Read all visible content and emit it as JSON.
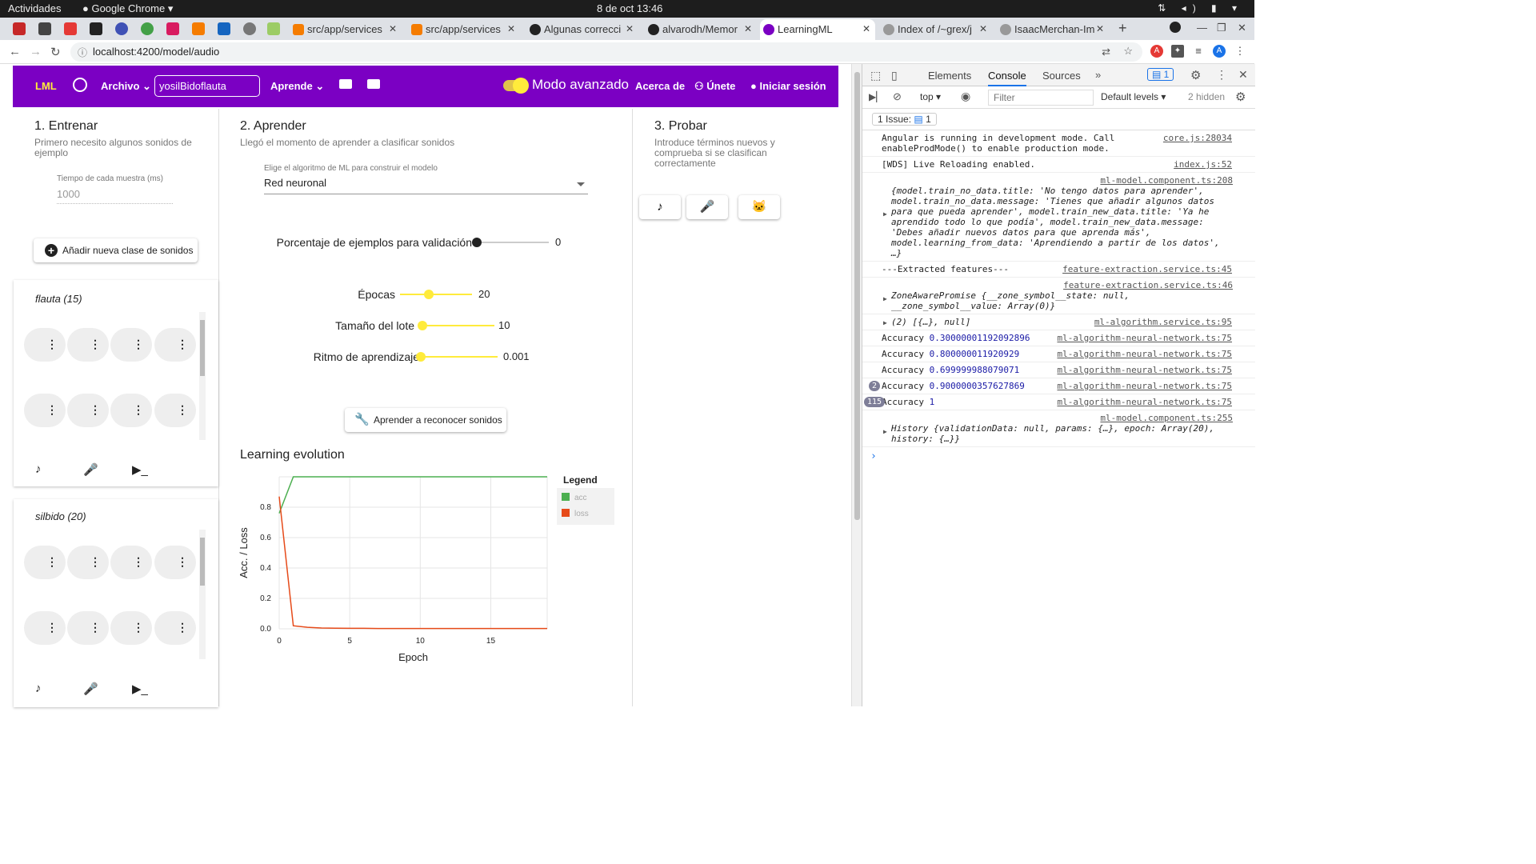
{
  "os": {
    "activities": "Actividades",
    "app_name": "Google Chrome",
    "clock": "8 de oct  13:46"
  },
  "browser": {
    "tabs": [
      {
        "title": "src/app/services",
        "color": "#f57c00"
      },
      {
        "title": "src/app/services",
        "color": "#f57c00"
      },
      {
        "title": "Algunas correcci",
        "color": "#222222"
      },
      {
        "title": "alvarodh/Memor",
        "color": "#222222"
      },
      {
        "title": "LearningML",
        "color": "#7b00c3"
      },
      {
        "title": "Index of /~grex/j",
        "color": "#888888"
      },
      {
        "title": "IsaacMerchan-Im",
        "color": "#888888"
      }
    ],
    "url": "localhost:4200/model/audio"
  },
  "navbar": {
    "logo": "LML",
    "archivo": "Archivo",
    "project_name": "yosilBidoflauta",
    "aprende": "Aprende",
    "modo": "Modo avanzado",
    "acerca": "Acerca de",
    "unete": "Únete",
    "login": "Iniciar sesión"
  },
  "entrenar": {
    "title": "1. Entrenar",
    "subtitle": "Primero necesito algunos sonidos de ejemplo",
    "sample_time_label": "Tiempo de cada muestra (ms)",
    "sample_time_value": "1000",
    "add_class": "Añadir nueva clase de sonidos",
    "classes": [
      {
        "name": "flauta (15)"
      },
      {
        "name": "silbido (20)"
      }
    ]
  },
  "aprender": {
    "title": "2. Aprender",
    "subtitle": "Llegó el momento de aprender a clasificar sonidos",
    "algo_label": "Elige el algoritmo de ML para construir el modelo",
    "algo_value": "Red neuronal",
    "validation_label": "Porcentaje de ejemplos para validación",
    "validation_value": "0",
    "validation_fraction": 0,
    "epochs_label": "Épocas",
    "epochs_value": "20",
    "epochs_fraction": 0.4,
    "batch_label": "Tamaño del lote",
    "batch_value": "10",
    "batch_fraction": 0.0,
    "lr_label": "Ritmo de aprendizaje",
    "lr_value": "0.001",
    "lr_fraction": 0.0,
    "learn_button": "Aprender a reconocer sonidos"
  },
  "probar": {
    "title": "3. Probar",
    "subtitle": "Introduce términos nuevos y comprueba si se clasifican correctamente"
  },
  "chart_data": {
    "type": "line",
    "title": "Learning evolution",
    "xlabel": "Epoch",
    "ylabel": "Acc. / Loss",
    "xlim": [
      0,
      19
    ],
    "ylim": [
      0,
      1
    ],
    "x_ticks": [
      0,
      5,
      10,
      15
    ],
    "y_ticks": [
      0.0,
      0.2,
      0.4,
      0.6,
      0.8
    ],
    "legend_title": "Legend",
    "legend_position": "right",
    "series": [
      {
        "name": "acc",
        "color": "#4caf50",
        "x": [
          0,
          1,
          2,
          3,
          4,
          5,
          6,
          7,
          8,
          9,
          10,
          11,
          12,
          13,
          14,
          15,
          16,
          17,
          18,
          19
        ],
        "values": [
          0.76,
          1,
          1,
          1,
          1,
          1,
          1,
          1,
          1,
          1,
          1,
          1,
          1,
          1,
          1,
          1,
          1,
          1,
          1,
          1
        ]
      },
      {
        "name": "loss",
        "color": "#e64a19",
        "x": [
          0,
          1,
          2,
          3,
          4,
          5,
          6,
          7,
          8,
          9,
          10,
          11,
          12,
          13,
          14,
          15,
          16,
          17,
          18,
          19
        ],
        "values": [
          0.87,
          0.02,
          0.01,
          0.005,
          0.004,
          0.003,
          0.003,
          0.002,
          0.002,
          0.002,
          0.002,
          0.002,
          0.002,
          0.002,
          0.002,
          0.002,
          0.002,
          0.002,
          0.002,
          0.002
        ]
      }
    ],
    "grid": true
  },
  "devtools": {
    "tabs": [
      "Elements",
      "Console",
      "Sources"
    ],
    "issues_badge": "1",
    "context": "top",
    "filter_placeholder": "Filter",
    "levels": "Default levels",
    "hidden": "2 hidden",
    "issue_bar": "1 Issue:",
    "issue_count": "1",
    "messages": [
      {
        "text": "Angular is running in development mode. Call enableProdMode() to enable production mode.",
        "src": "core.js:28034"
      },
      {
        "text": "[WDS] Live Reloading enabled.",
        "src": "index.js:52"
      },
      {
        "src_line": "ml-model.component.ts:208",
        "text": "{model.train_no_data.title: 'No tengo datos para aprender', model.train_no_data.message: 'Tienes que añadir algunos datos para que pueda aprender', model.train_new_data.title: 'Ya he aprendido todo lo que podía', model.train_new_data.message: 'Debes añadir nuevos datos para que aprenda más', model.learning_from_data: 'Aprendiendo a partir de los datos', …}"
      },
      {
        "text": "---Extracted features---",
        "src": "feature-extraction.service.ts:45"
      },
      {
        "src_line": "feature-extraction.service.ts:46",
        "text": "ZoneAwarePromise {__zone_symbol__state: null, __zone_symbol__value: Array(0)}"
      },
      {
        "text": "(2) [{…}, null]",
        "src": "ml-algorithm.service.ts:95"
      },
      {
        "text": "Accuracy ",
        "num": "0.30000001192092896",
        "src": "ml-algorithm-neural-network.ts:75"
      },
      {
        "text": "Accuracy ",
        "num": "0.800000011920929",
        "src": "ml-algorithm-neural-network.ts:75"
      },
      {
        "text": "Accuracy ",
        "num": "0.699999988079071",
        "src": "ml-algorithm-neural-network.ts:75"
      },
      {
        "badge": "2",
        "text": "Accuracy ",
        "num": "0.9000000357627869",
        "src": "ml-algorithm-neural-network.ts:75"
      },
      {
        "badge": "115",
        "text": "Accuracy ",
        "num": "1",
        "src": "ml-algorithm-neural-network.ts:75"
      },
      {
        "src_line": "ml-model.component.ts:255",
        "text": "History {validationData: null, params: {…}, epoch: Array(20), history: {…}}"
      }
    ],
    "prompt": "›"
  }
}
